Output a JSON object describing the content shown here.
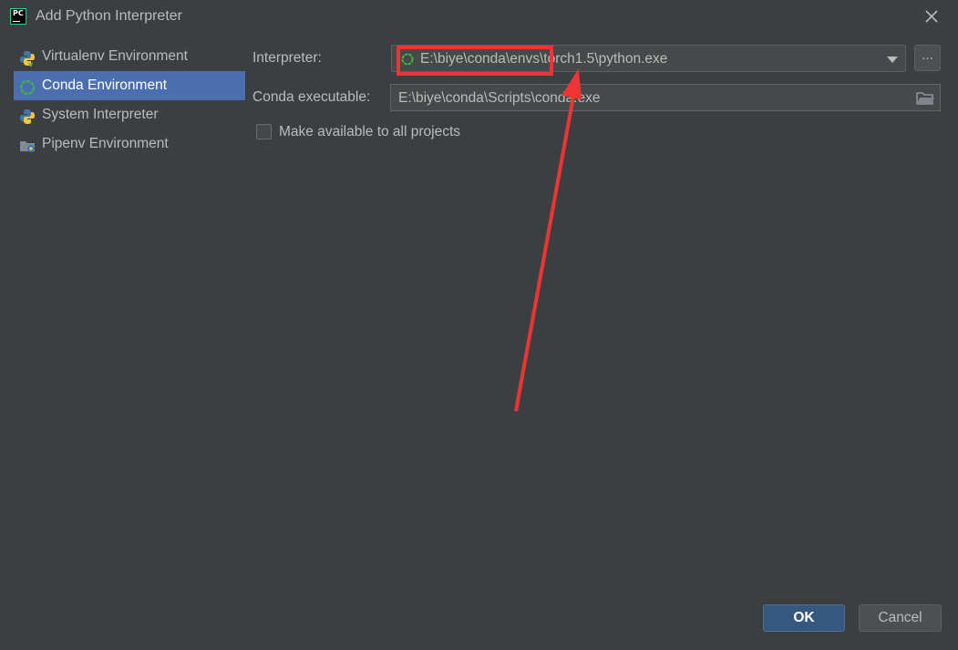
{
  "window": {
    "title": "Add Python Interpreter",
    "app_icon_text": "PC"
  },
  "sidebar": {
    "items": [
      {
        "label": "Virtualenv Environment",
        "icon": "python-venv-icon",
        "selected": false
      },
      {
        "label": "Conda Environment",
        "icon": "conda-icon",
        "selected": true
      },
      {
        "label": "System Interpreter",
        "icon": "python-icon",
        "selected": false
      },
      {
        "label": "Pipenv Environment",
        "icon": "pipenv-icon",
        "selected": false
      }
    ]
  },
  "form": {
    "interpreter_label": "Interpreter:",
    "interpreter_value": "E:\\biye\\conda\\envs\\torch1.5\\python.exe",
    "browse_label": "...",
    "conda_label": "Conda executable:",
    "conda_value": "E:\\biye\\conda\\Scripts\\conda.exe",
    "make_available_label": "Make available to all projects",
    "make_available_checked": false
  },
  "buttons": {
    "ok": "OK",
    "cancel": "Cancel"
  },
  "colors": {
    "background": "#3c3f41",
    "selection": "#4b6eaf",
    "ok_button": "#365880",
    "annotation": "#f03434"
  }
}
